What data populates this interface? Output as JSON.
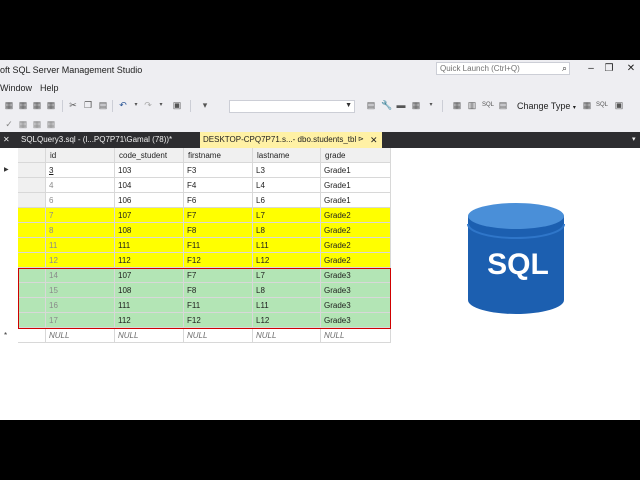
{
  "app": {
    "title": "oft SQL Server Management Studio",
    "quick_launch_placeholder": "Quick Launch (Ctrl+Q)"
  },
  "menu": {
    "window": "Window",
    "help": "Help"
  },
  "toolbar": {
    "change_type": "Change Type",
    "sql_label": "SQL"
  },
  "tabs": [
    {
      "label": "SQLQuery3.sql - (l...PQ7P71\\Gamal (78))*",
      "active": false
    },
    {
      "label": "DESKTOP-CPQ7P71.s...- dbo.students_tbl",
      "active": true
    }
  ],
  "grid": {
    "columns": [
      "id",
      "code_student",
      "firstname",
      "lastname",
      "grade"
    ],
    "rows": [
      [
        "3",
        "103",
        "F3",
        "L3",
        "Grade1"
      ],
      [
        "4",
        "104",
        "F4",
        "L4",
        "Grade1"
      ],
      [
        "6",
        "106",
        "F6",
        "L6",
        "Grade1"
      ],
      [
        "7",
        "107",
        "F7",
        "L7",
        "Grade2"
      ],
      [
        "8",
        "108",
        "F8",
        "L8",
        "Grade2"
      ],
      [
        "11",
        "111",
        "F11",
        "L11",
        "Grade2"
      ],
      [
        "12",
        "112",
        "F12",
        "L12",
        "Grade2"
      ],
      [
        "14",
        "107",
        "F7",
        "L7",
        "Grade3"
      ],
      [
        "15",
        "108",
        "F8",
        "L8",
        "Grade3"
      ],
      [
        "16",
        "111",
        "F11",
        "L11",
        "Grade3"
      ],
      [
        "17",
        "112",
        "F12",
        "L12",
        "Grade3"
      ]
    ],
    "row_colors": [
      "none",
      "none",
      "none",
      "yellow",
      "yellow",
      "yellow",
      "yellow",
      "green",
      "green",
      "green",
      "green"
    ],
    "null_row": [
      "NULL",
      "NULL",
      "NULL",
      "NULL",
      "NULL"
    ],
    "row_marker_current": "▶",
    "row_marker_new": "*"
  },
  "logo": {
    "text": "SQL",
    "color_top": "#4a8fd8",
    "color_body": "#1c5fb0"
  },
  "colors": {
    "yellow": "#ffff00",
    "green": "#b3e5b5",
    "red_border": "#d00000",
    "tab_active": "#fff1a5",
    "tab_strip": "#2d2d30"
  },
  "icons": [
    "undo-icon",
    "redo-icon",
    "save-icon",
    "search-icon",
    "close-icon",
    "pin-icon"
  ]
}
